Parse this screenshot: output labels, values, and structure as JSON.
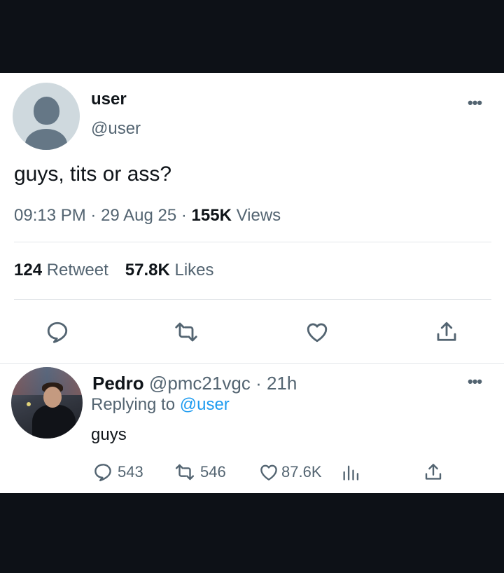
{
  "tweet": {
    "author_name": "user",
    "author_handle": "@user",
    "more_label": "•••",
    "text": "guys, tits or ass?",
    "time": "09:13 PM",
    "date": "29 Aug 25",
    "views_count": "155K",
    "views_label": "Views",
    "separator": "·",
    "retweet_count": "124",
    "retweet_label": "Retweet",
    "likes_count": "57.8K",
    "likes_label": "Likes",
    "actions": [
      "reply-icon",
      "retweet-icon",
      "like-icon",
      "share-icon"
    ]
  },
  "reply": {
    "author_name": "Pedro",
    "author_handle": "@pmc21vgc",
    "age": "· 21h",
    "replying_label": "Replying to",
    "replying_mention": "@user",
    "more_label": "•••",
    "text": "guys",
    "reply_count": "543",
    "retweet_count": "546",
    "like_count": "87.6K",
    "actions": [
      "reply-icon",
      "retweet-icon",
      "like-icon",
      "views-icon",
      "share-icon"
    ]
  },
  "colors": {
    "background": "#0d1117",
    "card": "#ffffff",
    "text": "#0f1419",
    "secondary": "#536471",
    "link": "#1d9bf0",
    "divider": "#e3e7ea"
  }
}
